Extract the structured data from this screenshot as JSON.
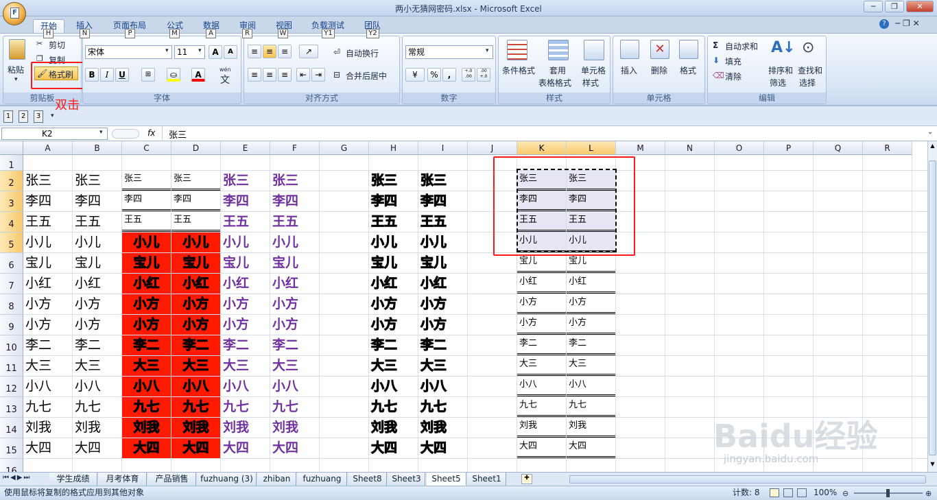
{
  "window": {
    "title": "两小无猜网密码.xlsx - Microsoft Excel",
    "controls": [
      "─",
      "❐",
      "✕"
    ],
    "office_button_glyph": "F"
  },
  "ribbon_tabs": [
    {
      "label": "开始",
      "key": "H",
      "active": true
    },
    {
      "label": "插入",
      "key": "N"
    },
    {
      "label": "页面布局",
      "key": "P"
    },
    {
      "label": "公式",
      "key": "M"
    },
    {
      "label": "数据",
      "key": "A"
    },
    {
      "label": "审阅",
      "key": "R"
    },
    {
      "label": "视图",
      "key": "W"
    },
    {
      "label": "负载测试",
      "key": "Y1"
    },
    {
      "label": "团队",
      "key": "Y2"
    }
  ],
  "clipboard": {
    "paste": "粘贴",
    "cut": "剪切",
    "copy": "复制",
    "format_painter": "格式刷",
    "group": "剪贴板"
  },
  "annotation": "双击",
  "font": {
    "name": "宋体",
    "size": "11",
    "grow": "A",
    "shrink": "A",
    "bold": "B",
    "italic": "I",
    "underline": "U",
    "font_color_glyph": "A",
    "wen": "wén",
    "wen2": "文",
    "group": "字体"
  },
  "alignment": {
    "wrap": "自动换行",
    "merge": "合并后居中",
    "group": "对齐方式"
  },
  "number": {
    "format": "常规",
    "percent": "%",
    "comma": ",",
    "dec_inc": "+.0 .00",
    "dec_dec": ".00 +.0",
    "group": "数字"
  },
  "styles": {
    "conditional": "条件格式",
    "table_fmt_1": "套用",
    "table_fmt_2": "表格格式",
    "cell_styles_1": "单元格",
    "cell_styles_2": "样式",
    "group": "样式"
  },
  "cells": {
    "insert": "插入",
    "delete": "删除",
    "format": "格式",
    "group": "单元格"
  },
  "editing": {
    "autosum": "自动求和",
    "fill": "填充",
    "clear": "清除",
    "sort_1": "排序和",
    "sort_2": "筛选",
    "find_1": "查找和",
    "find_2": "选择",
    "group": "编辑"
  },
  "qat": [
    "1",
    "2",
    "3"
  ],
  "formula_bar": {
    "name_box": "K2",
    "fx": "fx",
    "value": "张三"
  },
  "columns": [
    "A",
    "B",
    "C",
    "D",
    "E",
    "F",
    "G",
    "H",
    "I",
    "J",
    "K",
    "L",
    "M",
    "N",
    "O",
    "P",
    "Q",
    "R"
  ],
  "rows": [
    "1",
    "2",
    "3",
    "4",
    "5",
    "6",
    "7",
    "8",
    "9",
    "10",
    "11",
    "12",
    "13",
    "14",
    "15",
    "16"
  ],
  "names": [
    "张三",
    "李四",
    "王五",
    "小儿",
    "宝儿",
    "小红",
    "小方",
    "小方",
    "李二",
    "大三",
    "小八",
    "九七",
    "刘我",
    "大四"
  ],
  "sheet_tabs": [
    "学生成绩",
    "月考体育",
    "产品销售",
    "fuzhuang (3)",
    "zhiban",
    "fuzhuang",
    "Sheet8",
    "Sheet3",
    "Sheet5",
    "Sheet1"
  ],
  "active_sheet": "Sheet5",
  "status": {
    "message": "使用鼠标将复制的格式应用到其他对象",
    "count": "计数: 8",
    "zoom": "100%"
  },
  "watermark": {
    "brand": "Baidu经验",
    "url": "jingyan.baidu.com"
  }
}
